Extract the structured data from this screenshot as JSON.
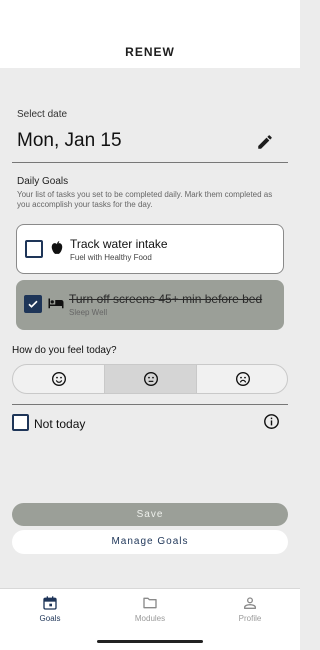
{
  "app": {
    "title": "RENEW"
  },
  "date": {
    "label": "Select date",
    "value": "Mon, Jan 15"
  },
  "goals": {
    "title": "Daily Goals",
    "description": "Your list of tasks you set to be completed daily. Mark them completed as you accomplish your tasks for the day.",
    "items": [
      {
        "name": "Track water intake",
        "category": "Fuel with Healthy Food",
        "checked": false,
        "icon": "apple-icon"
      },
      {
        "name": "Turn off screens 45+ min before bed",
        "category": "Sleep Well",
        "checked": true,
        "icon": "bed-icon"
      }
    ]
  },
  "mood": {
    "question": "How do you feel today?",
    "options": [
      {
        "icon": "happy-face-icon",
        "selected": false
      },
      {
        "icon": "neutral-face-icon",
        "selected": true
      },
      {
        "icon": "sad-face-icon",
        "selected": false
      }
    ]
  },
  "not_today": {
    "label": "Not today",
    "checked": false
  },
  "actions": {
    "save_label": "Save",
    "manage_label": "Manage Goals"
  },
  "nav": {
    "items": [
      {
        "label": "Goals",
        "icon": "calendar-icon",
        "active": true
      },
      {
        "label": "Modules",
        "icon": "folder-icon",
        "active": false
      },
      {
        "label": "Profile",
        "icon": "person-icon",
        "active": false
      }
    ]
  },
  "colors": {
    "accent": "#1e3558",
    "completed": "#9b9f98",
    "background": "#ececec"
  }
}
